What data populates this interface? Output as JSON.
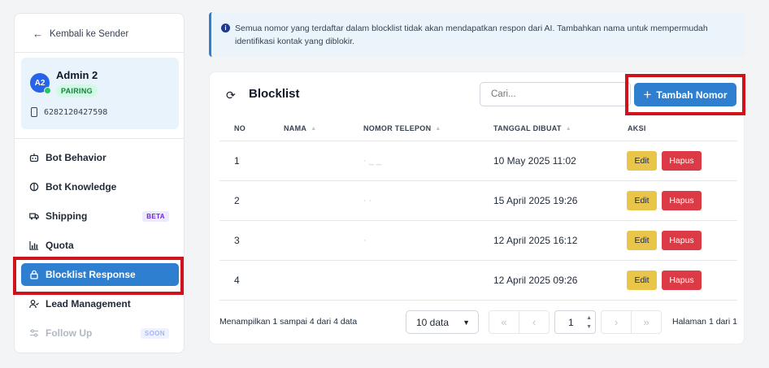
{
  "sidebar": {
    "back_label": "Kembali ke Sender",
    "profile": {
      "avatar_initials": "A2",
      "name": "Admin 2",
      "status": "PAIRING",
      "phone": "6282120427598"
    },
    "items": [
      {
        "label": "Bot Behavior",
        "icon": "robot-icon"
      },
      {
        "label": "Bot Knowledge",
        "icon": "brain-icon"
      },
      {
        "label": "Shipping",
        "icon": "truck-icon",
        "tag": "BETA"
      },
      {
        "label": "Quota",
        "icon": "bar-chart-icon"
      },
      {
        "label": "Blocklist Response",
        "icon": "lock-icon",
        "active": true
      },
      {
        "label": "Lead Management",
        "icon": "user-lead-icon"
      },
      {
        "label": "Follow Up",
        "icon": "sliders-icon",
        "tag": "SOON",
        "disabled": true
      }
    ]
  },
  "banner": {
    "text": "Semua nomor yang terdaftar dalam blocklist tidak akan mendapatkan respon dari AI. Tambahkan nama untuk mempermudah identifikasi kontak yang diblokir."
  },
  "card": {
    "title": "Blocklist",
    "search_placeholder": "Cari...",
    "add_button": "Tambah Nomor",
    "columns": [
      "NO",
      "NAMA",
      "NOMOR TELEPON",
      "TANGGAL DIBUAT",
      "AKSI"
    ],
    "rows": [
      {
        "no": "1",
        "nama": "",
        "phone": "· _ _",
        "date": "10 May 2025 11:02"
      },
      {
        "no": "2",
        "nama": "",
        "phone": "· ·",
        "date": "15 April 2025 19:26"
      },
      {
        "no": "3",
        "nama": "",
        "phone": "·",
        "date": "12 April 2025 16:12"
      },
      {
        "no": "4",
        "nama": "",
        "phone": "",
        "date": "12 April 2025 09:26"
      }
    ],
    "edit_label": "Edit",
    "delete_label": "Hapus",
    "footer_info": "Menampilkan 1 sampai 4 dari 4 data",
    "page_size": "10 data",
    "current_page": "1",
    "page_label": "Halaman 1 dari 1"
  },
  "colors": {
    "primary": "#2f7fd0",
    "edit": "#e9c54a",
    "delete": "#dc3a45",
    "highlight": "#d0121b"
  }
}
